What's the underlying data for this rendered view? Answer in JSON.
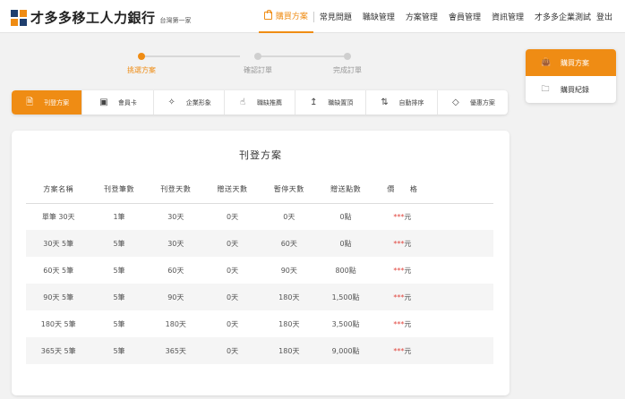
{
  "brand": {
    "title": "才多多移工人力銀行",
    "subtitle": "台灣第一家",
    "colors": [
      "#1f3f6e",
      "#ef8c14",
      "#ef8c14",
      "#1f3f6e"
    ]
  },
  "nav": {
    "items": [
      {
        "label": "購買方案",
        "active": true,
        "icon": "shopping-bag-icon"
      },
      {
        "label": "常見問題"
      },
      {
        "label": "職缺管理"
      },
      {
        "label": "方案管理"
      },
      {
        "label": "會員管理"
      },
      {
        "label": "資訊管理"
      },
      {
        "label": "才多多企業測試"
      },
      {
        "label": "登出"
      }
    ]
  },
  "stepper": {
    "steps": [
      {
        "label": "挑選方案",
        "active": true
      },
      {
        "label": "確認訂單",
        "active": false
      },
      {
        "label": "完成訂單",
        "active": false
      }
    ]
  },
  "tabs": [
    {
      "label": "刊登方案",
      "icon": "document-icon",
      "glyph": "🗎",
      "active": true
    },
    {
      "label": "會員卡",
      "icon": "card-icon",
      "glyph": "▣"
    },
    {
      "label": "企業形象",
      "icon": "sparkle-icon",
      "glyph": "✧"
    },
    {
      "label": "職缺推薦",
      "icon": "hand-icon",
      "glyph": "☝"
    },
    {
      "label": "職缺置頂",
      "icon": "arrow-up-icon",
      "glyph": "↥"
    },
    {
      "label": "自動排序",
      "icon": "sort-icon",
      "glyph": "⇅"
    },
    {
      "label": "優惠方案",
      "icon": "tag-icon",
      "glyph": "◇"
    }
  ],
  "plans": {
    "title": "刊登方案",
    "headers": [
      "方案名稱",
      "刊登筆數",
      "刊登天數",
      "贈送天數",
      "暫停天數",
      "贈送點數",
      "價　　格"
    ],
    "rows": [
      {
        "name": "單筆 30天",
        "count": "1筆",
        "days": "30天",
        "bonus_days": "0天",
        "pause_days": "0天",
        "bonus_points": "0點",
        "price_stars": "***",
        "price_unit": "元"
      },
      {
        "name": "30天 5筆",
        "count": "5筆",
        "days": "30天",
        "bonus_days": "0天",
        "pause_days": "60天",
        "bonus_points": "0點",
        "price_stars": "***",
        "price_unit": "元"
      },
      {
        "name": "60天 5筆",
        "count": "5筆",
        "days": "60天",
        "bonus_days": "0天",
        "pause_days": "90天",
        "bonus_points": "800點",
        "price_stars": "***",
        "price_unit": "元"
      },
      {
        "name": "90天 5筆",
        "count": "5筆",
        "days": "90天",
        "bonus_days": "0天",
        "pause_days": "180天",
        "bonus_points": "1,500點",
        "price_stars": "***",
        "price_unit": "元"
      },
      {
        "name": "180天 5筆",
        "count": "5筆",
        "days": "180天",
        "bonus_days": "0天",
        "pause_days": "180天",
        "bonus_points": "3,500點",
        "price_stars": "***",
        "price_unit": "元"
      },
      {
        "name": "365天 5筆",
        "count": "5筆",
        "days": "365天",
        "bonus_days": "0天",
        "pause_days": "180天",
        "bonus_points": "9,000點",
        "price_stars": "***",
        "price_unit": "元"
      }
    ]
  },
  "side_menu": [
    {
      "label": "購買方案",
      "icon": "shopping-bag-icon",
      "glyph": "👜",
      "active": true
    },
    {
      "label": "購買紀錄",
      "icon": "history-icon",
      "glyph": "🗀",
      "active": false
    }
  ],
  "accent_color": "#ef8c14"
}
